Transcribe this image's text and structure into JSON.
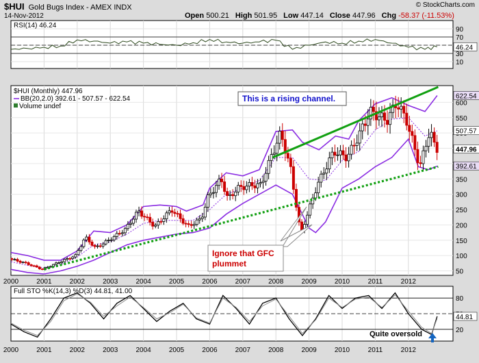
{
  "header": {
    "symbol": "$HUI",
    "name": "Gold Bugs Index - AMEX INDX",
    "date": "14-Nov-2012",
    "open_label": "Open",
    "open": "500.21",
    "high_label": "High",
    "high": "501.95",
    "low_label": "Low",
    "low": "447.14",
    "close_label": "Close",
    "close": "447.96",
    "chg_label": "Chg",
    "chg": "-58.37 (-11.53%)",
    "logo": "© StockCharts.com"
  },
  "colors": {
    "up": "#000000",
    "down": "#cc0000",
    "bb": "#8a2be2",
    "channel": "#11a011",
    "annotation": "#1010cc",
    "gfc": "#cc0000"
  },
  "chart_data": [
    {
      "type": "line",
      "title": "RSI(14) 46.24",
      "ylim": [
        0,
        100
      ],
      "y_ticks": [
        10,
        30,
        50,
        70,
        90
      ],
      "reference_lines": [
        30,
        70
      ],
      "last_label": "46.24",
      "x": [
        2000,
        2000.5,
        2001,
        2001.5,
        2002,
        2002.5,
        2003,
        2003.5,
        2004,
        2004.5,
        2005,
        2005.5,
        2006,
        2006.5,
        2007,
        2007.5,
        2008,
        2008.5,
        2009,
        2009.5,
        2010,
        2010.5,
        2011,
        2011.5,
        2012,
        2012.5,
        2012.87
      ],
      "values": [
        40,
        42,
        45,
        48,
        63,
        60,
        55,
        58,
        55,
        52,
        50,
        56,
        64,
        58,
        55,
        58,
        62,
        40,
        50,
        58,
        55,
        60,
        64,
        55,
        45,
        40,
        46
      ]
    },
    {
      "type": "candlestick",
      "title": "$HUI (Monthly) 447.96",
      "legend": [
        "$HUI (Monthly) 447.96",
        "BB(20,2.0) 392.61 - 507.57 - 622.54",
        "Volume undef"
      ],
      "ylim": [
        40,
        650
      ],
      "y_ticks": [
        50,
        100,
        150,
        200,
        250,
        300,
        350,
        400,
        450,
        500,
        550,
        600
      ],
      "x_ticks": [
        "2000",
        "2001",
        "2002",
        "2003",
        "2004",
        "2005",
        "2006",
        "2007",
        "2008",
        "2009",
        "2010",
        "2011",
        "2012"
      ],
      "price_labels": {
        "bb_upper": "622.54",
        "bb_mid": "507.57",
        "close": "447.96",
        "bb_lower": "392.61"
      },
      "anchors": [
        [
          2000,
          90
        ],
        [
          2000.5,
          75
        ],
        [
          2001,
          55
        ],
        [
          2001.5,
          78
        ],
        [
          2002,
          100
        ],
        [
          2002.3,
          160
        ],
        [
          2002.6,
          125
        ],
        [
          2003,
          150
        ],
        [
          2003.5,
          185
        ],
        [
          2003.9,
          245
        ],
        [
          2004.4,
          195
        ],
        [
          2004.9,
          250
        ],
        [
          2005.4,
          195
        ],
        [
          2005.8,
          220
        ],
        [
          2006,
          290
        ],
        [
          2006.4,
          350
        ],
        [
          2006.6,
          285
        ],
        [
          2006.9,
          320
        ],
        [
          2007.3,
          330
        ],
        [
          2007.6,
          330
        ],
        [
          2007.9,
          420
        ],
        [
          2008.2,
          500
        ],
        [
          2008.5,
          380
        ],
        [
          2008.8,
          170
        ],
        [
          2009.3,
          330
        ],
        [
          2009.8,
          440
        ],
        [
          2010.2,
          420
        ],
        [
          2010.5,
          480
        ],
        [
          2010.9,
          570
        ],
        [
          2011.4,
          540
        ],
        [
          2011.7,
          600
        ],
        [
          2012,
          540
        ],
        [
          2012.4,
          390
        ],
        [
          2012.7,
          510
        ],
        [
          2012.87,
          448
        ]
      ],
      "bb_upper": [
        [
          2000,
          110
        ],
        [
          2000.5,
          100
        ],
        [
          2001,
          85
        ],
        [
          2001.5,
          85
        ],
        [
          2002,
          115
        ],
        [
          2002.5,
          180
        ],
        [
          2003,
          175
        ],
        [
          2003.5,
          200
        ],
        [
          2004,
          260
        ],
        [
          2004.5,
          265
        ],
        [
          2005,
          260
        ],
        [
          2005.3,
          245
        ],
        [
          2005.8,
          265
        ],
        [
          2006,
          320
        ],
        [
          2006.5,
          370
        ],
        [
          2007,
          360
        ],
        [
          2007.5,
          380
        ],
        [
          2008,
          505
        ],
        [
          2008.5,
          510
        ],
        [
          2008.8,
          470
        ],
        [
          2009.3,
          445
        ],
        [
          2009.8,
          490
        ],
        [
          2010.2,
          480
        ],
        [
          2010.5,
          540
        ],
        [
          2011,
          595
        ],
        [
          2011.5,
          615
        ],
        [
          2012,
          590
        ],
        [
          2012.5,
          570
        ],
        [
          2012.87,
          622
        ]
      ],
      "bb_middle": [
        [
          2000,
          80
        ],
        [
          2000.5,
          68
        ],
        [
          2001,
          60
        ],
        [
          2001.5,
          70
        ],
        [
          2002,
          95
        ],
        [
          2002.5,
          135
        ],
        [
          2003,
          145
        ],
        [
          2003.5,
          170
        ],
        [
          2004,
          205
        ],
        [
          2004.5,
          215
        ],
        [
          2005,
          215
        ],
        [
          2005.5,
          215
        ],
        [
          2006,
          250
        ],
        [
          2006.5,
          300
        ],
        [
          2007,
          320
        ],
        [
          2007.5,
          345
        ],
        [
          2008,
          420
        ],
        [
          2008.5,
          420
        ],
        [
          2009,
          350
        ],
        [
          2009.5,
          345
        ],
        [
          2010,
          410
        ],
        [
          2010.5,
          440
        ],
        [
          2011,
          510
        ],
        [
          2011.5,
          545
        ],
        [
          2012,
          550
        ],
        [
          2012.5,
          490
        ],
        [
          2012.87,
          507
        ]
      ],
      "bb_lower": [
        [
          2000,
          55
        ],
        [
          2000.5,
          45
        ],
        [
          2001,
          40
        ],
        [
          2001.5,
          50
        ],
        [
          2002,
          65
        ],
        [
          2002.5,
          85
        ],
        [
          2003,
          110
        ],
        [
          2003.5,
          135
        ],
        [
          2004,
          150
        ],
        [
          2004.5,
          160
        ],
        [
          2005,
          170
        ],
        [
          2005.5,
          175
        ],
        [
          2006,
          190
        ],
        [
          2006.5,
          235
        ],
        [
          2007,
          270
        ],
        [
          2007.5,
          300
        ],
        [
          2008,
          330
        ],
        [
          2008.5,
          300
        ],
        [
          2009,
          190
        ],
        [
          2009.2,
          175
        ],
        [
          2009.5,
          210
        ],
        [
          2010,
          320
        ],
        [
          2010.5,
          350
        ],
        [
          2011,
          390
        ],
        [
          2011.5,
          420
        ],
        [
          2012,
          480
        ],
        [
          2012.3,
          390
        ],
        [
          2012.6,
          380
        ],
        [
          2012.87,
          392
        ]
      ],
      "channel_upper": [
        [
          2007.9,
          420
        ],
        [
          2012.9,
          650
        ]
      ],
      "channel_lower": [
        [
          2001,
          55
        ],
        [
          2012.9,
          390
        ]
      ],
      "annotations": [
        "This is a rising channel.",
        "Ignore that GFC plummet"
      ]
    },
    {
      "type": "line",
      "title": "Full STO %K(14,3) %D(3) 44.81, 41.00",
      "ylim": [
        0,
        100
      ],
      "y_ticks": [
        20,
        50,
        80
      ],
      "reference_lines": [
        20,
        80
      ],
      "last_label": "44.81",
      "x_ticks": [
        "2000",
        "2001",
        "2002",
        "2003",
        "2004",
        "2005",
        "2006",
        "2007",
        "2008",
        "2009",
        "2010",
        "2011",
        "2012"
      ],
      "x": [
        2000,
        2000.4,
        2000.8,
        2001.2,
        2001.6,
        2002,
        2002.4,
        2002.8,
        2003.2,
        2003.6,
        2004,
        2004.4,
        2004.8,
        2005.2,
        2005.6,
        2006,
        2006.4,
        2006.8,
        2007.2,
        2007.6,
        2008,
        2008.4,
        2008.8,
        2009.2,
        2009.6,
        2010,
        2010.4,
        2010.8,
        2011.2,
        2011.6,
        2012,
        2012.4,
        2012.7,
        2012.87
      ],
      "series": [
        {
          "values": [
            30,
            15,
            5,
            40,
            80,
            90,
            70,
            40,
            70,
            85,
            60,
            35,
            55,
            70,
            40,
            30,
            85,
            60,
            30,
            70,
            80,
            40,
            8,
            40,
            85,
            60,
            80,
            85,
            60,
            90,
            50,
            20,
            10,
            45
          ]
        },
        {
          "values": [
            32,
            18,
            8,
            35,
            75,
            88,
            72,
            45,
            65,
            82,
            62,
            40,
            52,
            68,
            42,
            32,
            80,
            62,
            35,
            65,
            78,
            45,
            12,
            38,
            80,
            62,
            78,
            82,
            62,
            86,
            55,
            24,
            12,
            41
          ]
        }
      ],
      "annotations": [
        "Quite oversold"
      ]
    }
  ]
}
